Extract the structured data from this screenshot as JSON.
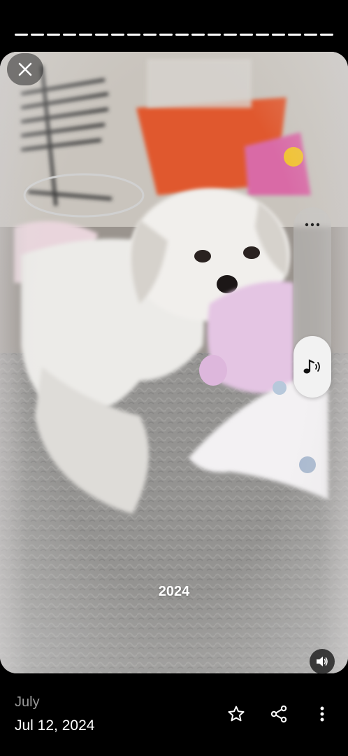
{
  "story": {
    "segments_total": 20,
    "segments_viewed": 20
  },
  "photo": {
    "year_label": "2024"
  },
  "info": {
    "month": "July",
    "date": "Jul 12, 2024"
  },
  "icons": {
    "close": "close-icon",
    "more": "more-horizontal-icon",
    "music": "music-note-icon",
    "sound": "volume-icon",
    "favorite": "star-outline-icon",
    "share": "share-icon",
    "menu": "more-vertical-icon"
  }
}
